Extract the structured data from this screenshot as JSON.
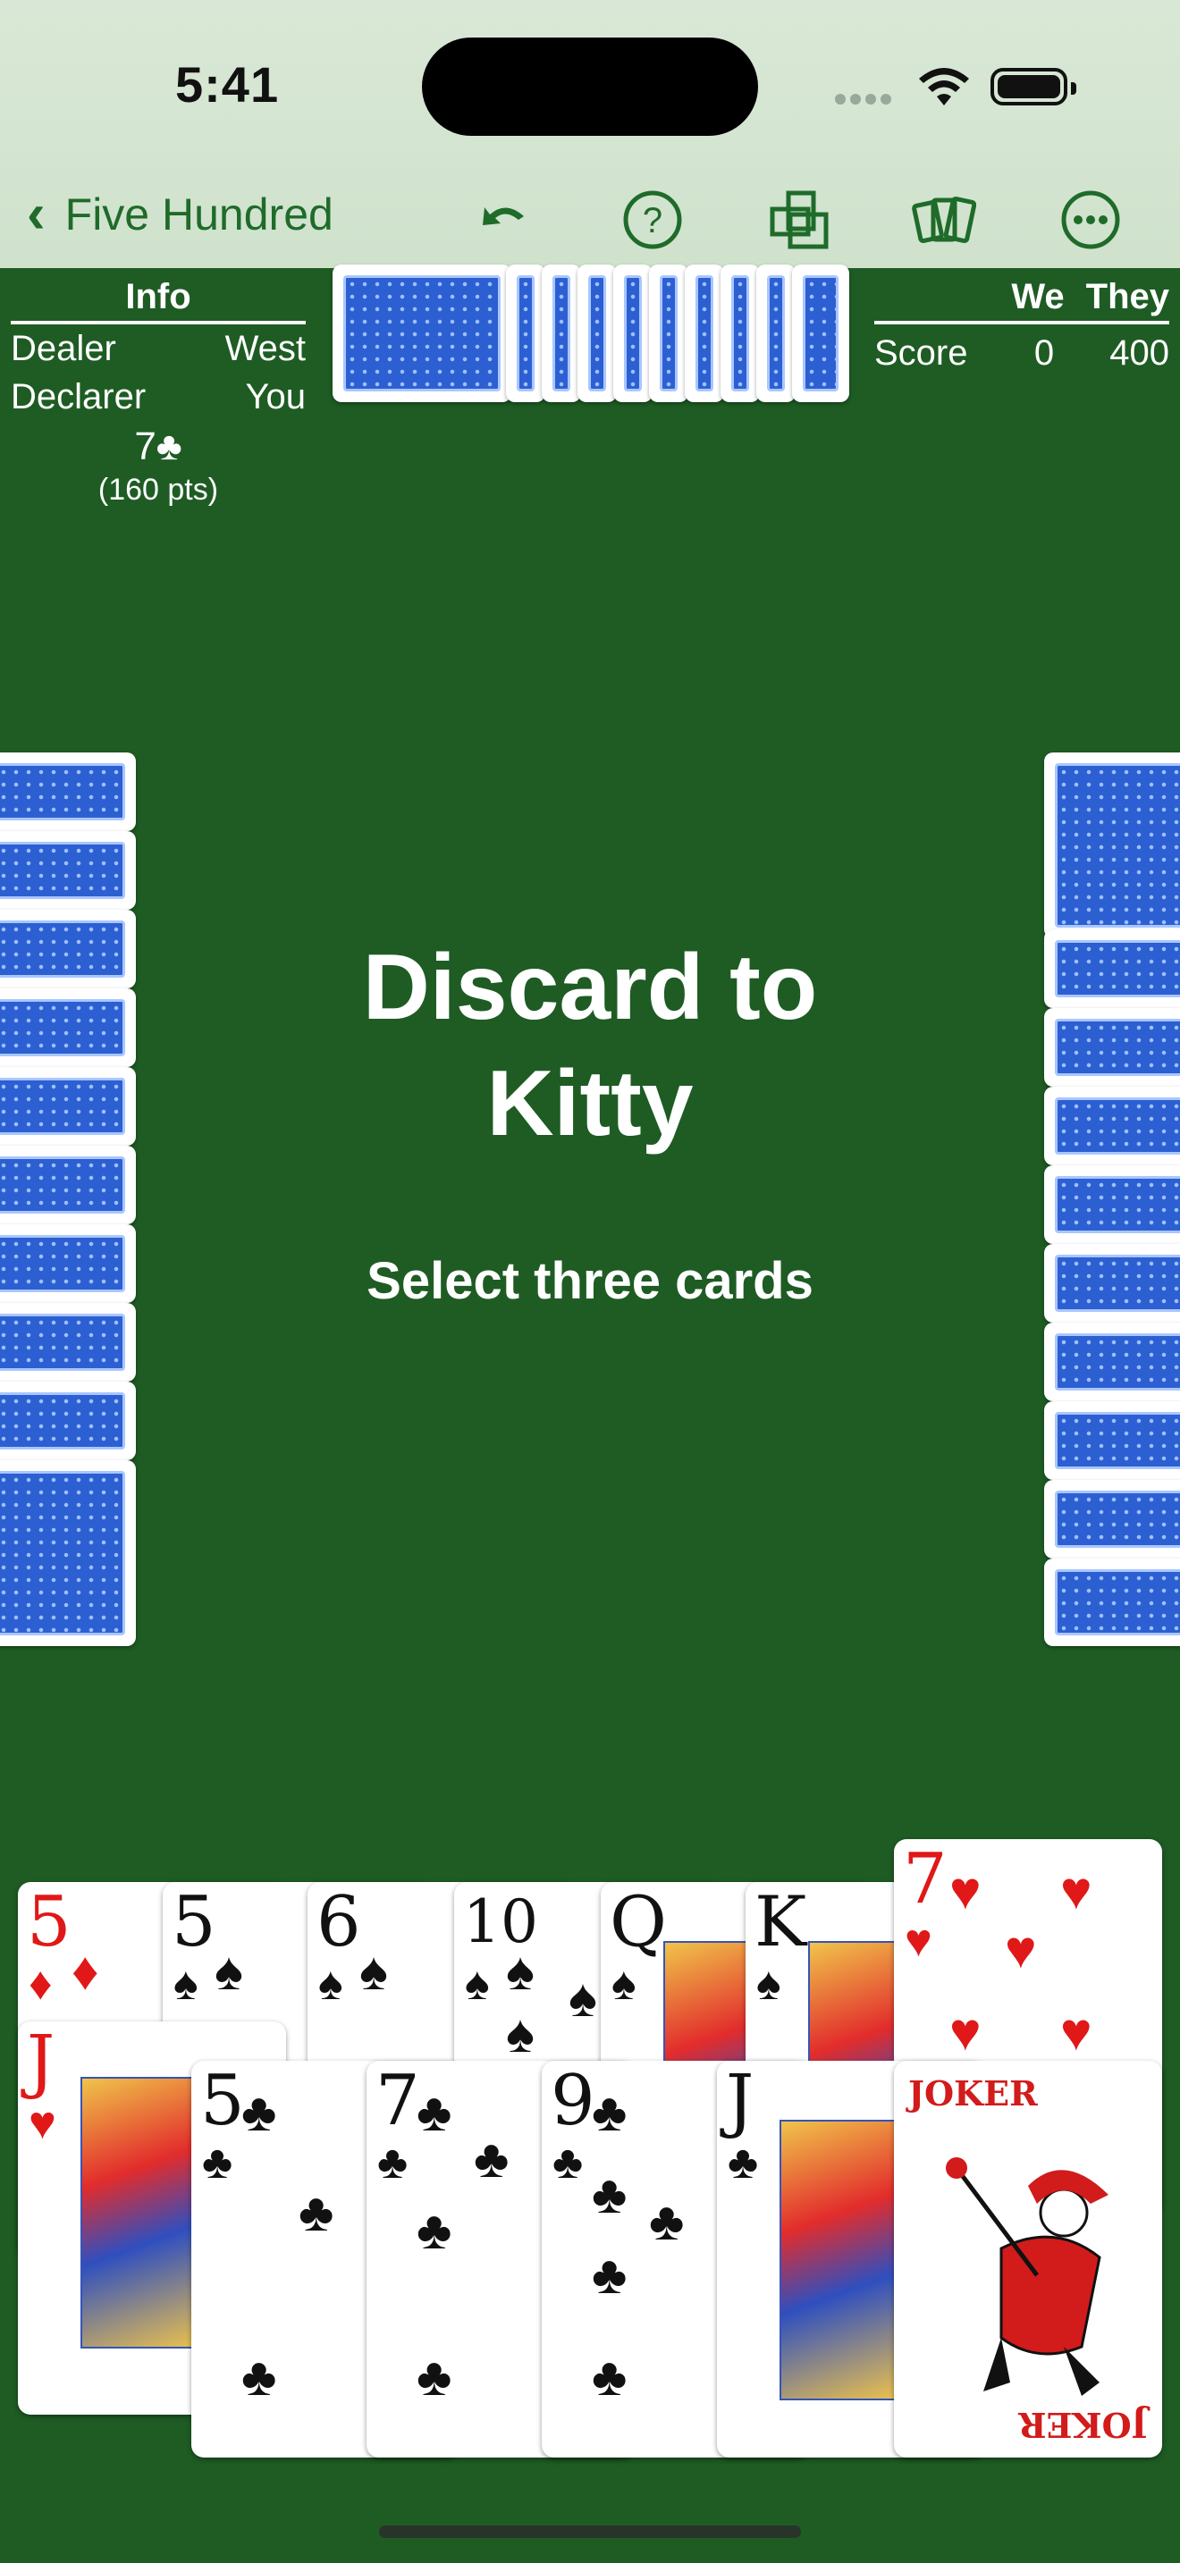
{
  "status_bar": {
    "time": "5:41"
  },
  "nav": {
    "back_label": "Five Hundred"
  },
  "info_panel": {
    "header": "Info",
    "rows": [
      {
        "label": "Dealer",
        "value": "West"
      },
      {
        "label": "Declarer",
        "value": "You"
      }
    ],
    "bid": "7♣",
    "bid_points": "(160 pts)"
  },
  "score_panel": {
    "col_we": "We",
    "col_they": "They",
    "row_label": "Score",
    "we": "0",
    "they": "400"
  },
  "message": {
    "title_line1": "Discard to",
    "title_line2": "Kitty",
    "subtitle": "Select three cards"
  },
  "hand": {
    "back_row": [
      {
        "rank": "5",
        "suit": "♦",
        "color": "red"
      },
      {
        "rank": "5",
        "suit": "♠",
        "color": "black"
      },
      {
        "rank": "6",
        "suit": "♠",
        "color": "black"
      },
      {
        "rank": "10",
        "suit": "♠",
        "color": "black"
      },
      {
        "rank": "Q",
        "suit": "♠",
        "color": "black"
      },
      {
        "rank": "K",
        "suit": "♠",
        "color": "black"
      },
      {
        "rank": "7",
        "suit": "♥",
        "color": "red"
      }
    ],
    "front_row": [
      {
        "rank": "J",
        "suit": "♥",
        "color": "red"
      },
      {
        "rank": "5",
        "suit": "♣",
        "color": "black"
      },
      {
        "rank": "7",
        "suit": "♣",
        "color": "black"
      },
      {
        "rank": "9",
        "suit": "♣",
        "color": "black"
      },
      {
        "rank": "J",
        "suit": "♣",
        "color": "black"
      },
      {
        "rank": "JOKER",
        "suit": "",
        "color": "red"
      }
    ]
  },
  "colors": {
    "felt": "#1e5c24",
    "nav_tint": "#1f6b2a",
    "card_back": "#2c5fd1"
  }
}
